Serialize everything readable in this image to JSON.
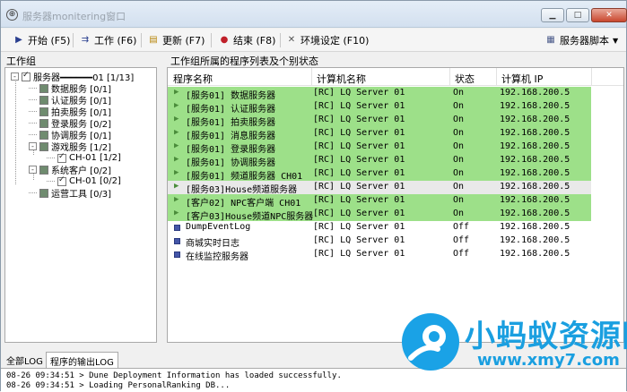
{
  "window": {
    "title": "服务器monitering窗口",
    "icon": "globe-icon",
    "controls": [
      "minimize",
      "maximize",
      "close"
    ]
  },
  "toolbar": {
    "start_label": "开始 (F5)",
    "work_label": "工作 (F6)",
    "update_label": "更新 (F7)",
    "end_label": "结束 (F8)",
    "settings_label": "环境设定 (F10)",
    "script_label": "服务器脚本"
  },
  "work_group": {
    "label": "工作组",
    "tree": [
      {
        "label": "服务器━━━━━━01 [1/13]",
        "level": 0,
        "expander": "-",
        "checked": true
      },
      {
        "label": "数据服务 [0/1]",
        "level": 1,
        "checked": false
      },
      {
        "label": "认证服务 [0/1]",
        "level": 1,
        "checked": false
      },
      {
        "label": "拍卖服务 [0/1]",
        "level": 1,
        "checked": false
      },
      {
        "label": "登录服务 [0/2]",
        "level": 1,
        "checked": false
      },
      {
        "label": "协调服务 [0/1]",
        "level": 1,
        "checked": false
      },
      {
        "label": "游戏服务 [1/2]",
        "level": 1,
        "expander": "-",
        "checked": false
      },
      {
        "label": "CH-01 [1/2]",
        "level": 2,
        "checked": true
      },
      {
        "label": "系统客户 [0/2]",
        "level": 1,
        "expander": "-",
        "checked": false
      },
      {
        "label": "CH-01 [0/2]",
        "level": 2,
        "checked": true
      },
      {
        "label": "运营工具 [0/3]",
        "level": 1,
        "checked": false
      }
    ]
  },
  "program_list": {
    "label": "工作组所属的程序列表及个别状态",
    "columns": [
      "程序名称",
      "计算机名称",
      "状态",
      "计算机 IP"
    ],
    "rows": [
      {
        "name": "[服务01] 数据服务器",
        "computer": "[RC] LQ Server 01",
        "status": "On",
        "ip": "192.168.200.5",
        "style": "green",
        "icon": "play"
      },
      {
        "name": "[服务01] 认证服务器",
        "computer": "[RC] LQ Server 01",
        "status": "On",
        "ip": "192.168.200.5",
        "style": "green",
        "icon": "play"
      },
      {
        "name": "[服务01] 拍卖服务器",
        "computer": "[RC] LQ Server 01",
        "status": "On",
        "ip": "192.168.200.5",
        "style": "green",
        "icon": "play"
      },
      {
        "name": "[服务01] 消息服务器",
        "computer": "[RC] LQ Server 01",
        "status": "On",
        "ip": "192.168.200.5",
        "style": "green",
        "icon": "play"
      },
      {
        "name": "[服务01] 登录服务器",
        "computer": "[RC] LQ Server 01",
        "status": "On",
        "ip": "192.168.200.5",
        "style": "green",
        "icon": "play"
      },
      {
        "name": "[服务01] 协调服务器",
        "computer": "[RC] LQ Server 01",
        "status": "On",
        "ip": "192.168.200.5",
        "style": "green",
        "icon": "play"
      },
      {
        "name": "[服务01] 频道服务器 CH01",
        "computer": "[RC] LQ Server 01",
        "status": "On",
        "ip": "192.168.200.5",
        "style": "green",
        "icon": "play"
      },
      {
        "name": "[服务03]House频道服务器",
        "computer": "[RC] LQ Server 01",
        "status": "On",
        "ip": "192.168.200.5",
        "style": "gray",
        "icon": "play"
      },
      {
        "name": "[客户02] NPC客户端_CH01",
        "computer": "[RC] LQ Server 01",
        "status": "On",
        "ip": "192.168.200.5",
        "style": "green",
        "icon": "play"
      },
      {
        "name": "[客户03]House频道NPC服务器",
        "computer": "[RC] LQ Server 01",
        "status": "On",
        "ip": "192.168.200.5",
        "style": "green",
        "icon": "play"
      },
      {
        "name": "DumpEventLog",
        "computer": "[RC] LQ Server 01",
        "status": "Off",
        "ip": "192.168.200.5",
        "style": "white",
        "icon": "stop"
      },
      {
        "name": "商城实时日志",
        "computer": "[RC] LQ Server 01",
        "status": "Off",
        "ip": "192.168.200.5",
        "style": "white",
        "icon": "stop"
      },
      {
        "name": "在线监控服务器",
        "computer": "[RC] LQ Server 01",
        "status": "Off",
        "ip": "192.168.200.5",
        "style": "white",
        "icon": "stop"
      }
    ]
  },
  "log_tabs": [
    "全部LOG",
    "程序的输出LOG"
  ],
  "log_lines": [
    "08-26 09:34:51 > Dune Deployment Information has loaded successfully.",
    "08-26 09:34:51 > Loading PersonalRanking DB..."
  ],
  "watermark": {
    "text1": "小蚂蚁资源网",
    "text2": "www.xmy7.com",
    "color": "#1a9fe0"
  }
}
